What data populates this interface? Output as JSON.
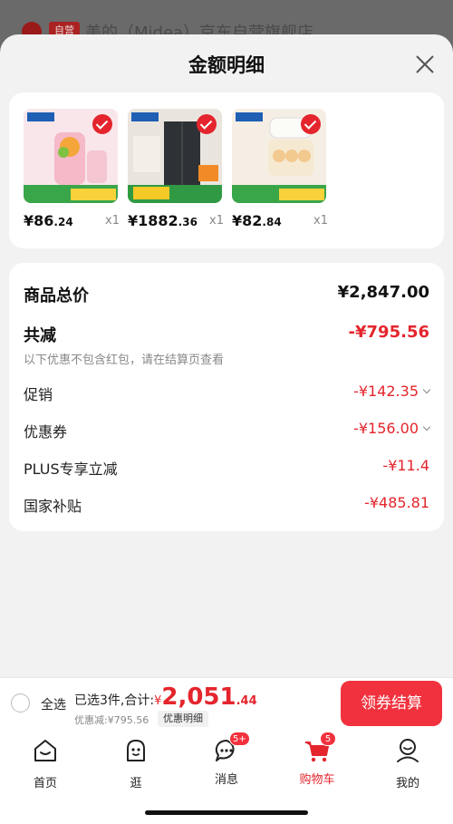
{
  "background": {
    "store_tag": "自营",
    "store_name": "美的（Midea）京东自营旗舰店"
  },
  "sheet": {
    "title": "金额明细"
  },
  "products": [
    {
      "price_main": "¥86",
      "price_dec": ".24",
      "qty": "x1"
    },
    {
      "price_main": "¥1882",
      "price_dec": ".36",
      "qty": "x1"
    },
    {
      "price_main": "¥82",
      "price_dec": ".84",
      "qty": "x1"
    }
  ],
  "detail": {
    "total_label": "商品总价",
    "total_value": "¥2,847.00",
    "reduce_label": "共减",
    "reduce_value": "-¥795.56",
    "note": "以下优惠不包含红包，请在结算页查看",
    "promo_label": "促销",
    "promo_value": "-¥142.35",
    "coupon_label": "优惠券",
    "coupon_value": "-¥156.00",
    "plus_label": "PLUS专享立减",
    "plus_value": "-¥11.4",
    "subsidy_label": "国家补贴",
    "subsidy_value": "-¥485.81"
  },
  "checkout": {
    "select_all": "全选",
    "selected_text": "已选3件,合计:",
    "currency": "¥",
    "amount_int": "2,051",
    "amount_dec": ".44",
    "discount_text": "优惠减:¥795.56",
    "detail_link": "优惠明细",
    "pay_button": "领券结算"
  },
  "tabs": [
    {
      "label": "首页",
      "icon": "home-icon"
    },
    {
      "label": "逛",
      "icon": "browse-icon"
    },
    {
      "label": "消息",
      "icon": "message-icon",
      "badge": "5+"
    },
    {
      "label": "购物车",
      "icon": "cart-icon",
      "badge": "5"
    },
    {
      "label": "我的",
      "icon": "profile-icon"
    }
  ],
  "colors": {
    "accent": "#e4252d",
    "button": "#f1323e"
  }
}
